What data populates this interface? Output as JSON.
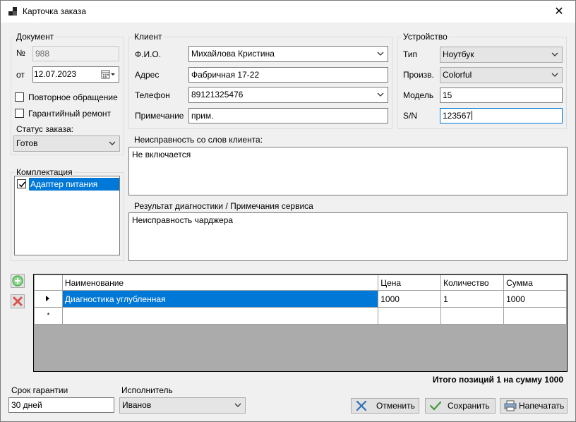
{
  "window": {
    "title": "Карточка заказа",
    "close_glyph": "✕",
    "icon": "app-icon"
  },
  "document": {
    "group_title": "Документ",
    "number_label": "№",
    "number_value": "988",
    "date_label": "от",
    "date_value": "12.07.2023",
    "repeat_label": "Повторное обращение",
    "warranty_repair_label": "Гарантийный ремонт",
    "status_label": "Статус заказа:",
    "status_value": "Готов"
  },
  "kit": {
    "group_title": "Комплектация",
    "items": [
      {
        "label": "Адаптер питания",
        "checked": true
      }
    ]
  },
  "client": {
    "group_title": "Клиент",
    "name_label": "Ф.И.О.",
    "name_value": "Михайлова Кристина",
    "address_label": "Адрес",
    "address_value": "Фабричная 17-22",
    "phone_label": "Телефон",
    "phone_value": "89121325476",
    "note_label": "Примечание",
    "note_value": "прим."
  },
  "device": {
    "group_title": "Устройство",
    "type_label": "Тип",
    "type_value": "Ноутбук",
    "maker_label": "Произв.",
    "maker_value": "Colorful",
    "model_label": "Модель",
    "model_value": "15",
    "sn_label": "S/N",
    "sn_value": "123567"
  },
  "problem": {
    "label": "Неисправность со слов клиента:",
    "value": "Не включается"
  },
  "diagnosis": {
    "label": "Результат диагностики / Примечания сервиса",
    "value": "Неисправность чарджера"
  },
  "grid": {
    "columns": [
      "Наименование",
      "Цена",
      "Количество",
      "Сумма"
    ],
    "rows": [
      {
        "name": "Диагностика углубленная",
        "price": "1000",
        "qty": "1",
        "sum": "1000"
      }
    ],
    "new_row_marker": "*"
  },
  "total_text": "Итого позиций 1 на сумму 1000",
  "warranty": {
    "label": "Срок гарантии",
    "value": "30 дней"
  },
  "executor": {
    "label": "Исполнитель",
    "value": "Иванов"
  },
  "buttons": {
    "cancel": "Отменить",
    "save": "Сохранить",
    "print": "Напечатать"
  },
  "colors": {
    "accent": "#0078d7",
    "add_green": "#3caa3c",
    "remove_red": "#d9534f"
  }
}
